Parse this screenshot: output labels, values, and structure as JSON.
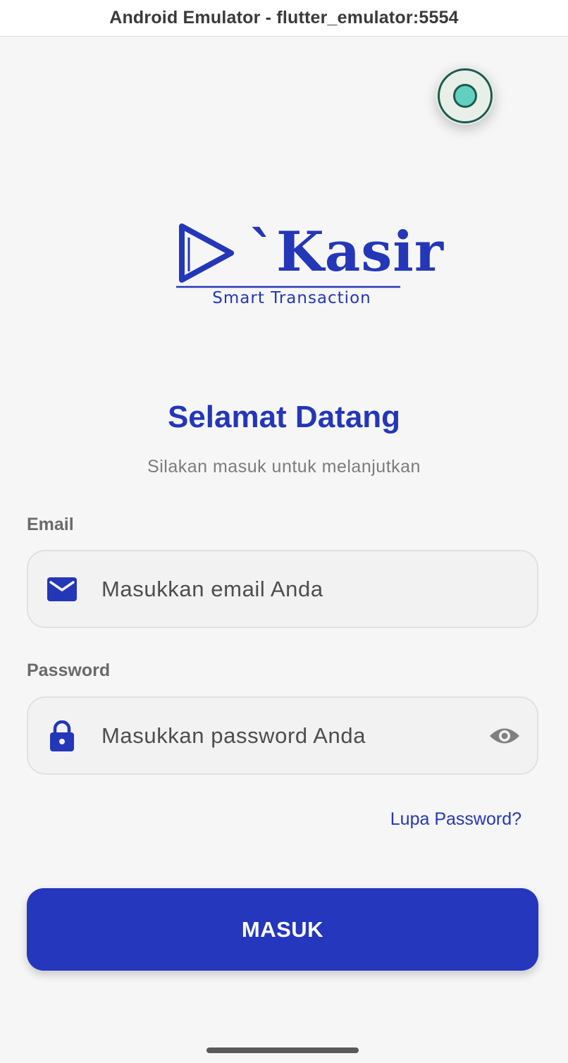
{
  "window": {
    "title": "Android Emulator - flutter_emulator:5554"
  },
  "floating_button": {
    "icon": "theme-toggle-icon"
  },
  "logo": {
    "brand": "`Kasir",
    "tagline": "Smart Transaction"
  },
  "welcome": {
    "title": "Selamat Datang",
    "subtitle": "Silakan masuk untuk melanjutkan"
  },
  "email": {
    "label": "Email",
    "placeholder": "Masukkan email Anda",
    "value": "",
    "icon": "mail-icon"
  },
  "password": {
    "label": "Password",
    "placeholder": "Masukkan password Anda",
    "value": "",
    "icon": "lock-icon",
    "toggle_icon": "eye-icon"
  },
  "forgot_password": "Lupa Password?",
  "login_button": "MASUK",
  "colors": {
    "primary": "#2437B8",
    "button": "#2437BD",
    "background": "#F6F6F6",
    "field": "#F2F2F2",
    "accent_teal": "#63CFBF"
  }
}
